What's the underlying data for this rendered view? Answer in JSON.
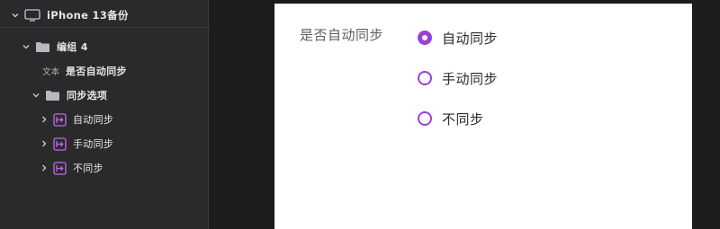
{
  "layers": {
    "root": {
      "label": "iPhone 13备份",
      "icon": "device-icon"
    },
    "group": {
      "label": "编组 4",
      "icon": "folder-icon"
    },
    "text_layer": {
      "tag": "文本",
      "label": "是否自动同步"
    },
    "options_group": {
      "label": "同步选项",
      "icon": "folder-icon"
    },
    "components": [
      {
        "label": "自动同步",
        "icon": "component-instance-icon"
      },
      {
        "label": "手动同步",
        "icon": "component-instance-icon"
      },
      {
        "label": "不同步",
        "icon": "component-instance-icon"
      }
    ]
  },
  "artboard": {
    "question": "是否自动同步",
    "options": [
      {
        "label": "自动同步",
        "checked": true
      },
      {
        "label": "手动同步",
        "checked": false
      },
      {
        "label": "不同步",
        "checked": false
      }
    ]
  },
  "colors": {
    "accent": "#9b3fd7",
    "panel_bg": "#2a2a2c",
    "canvas_bg": "#1c1c1e",
    "artboard_bg": "#ffffff"
  }
}
